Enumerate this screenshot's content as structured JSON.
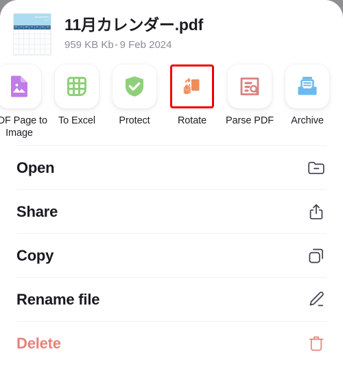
{
  "file": {
    "title": "11月カレンダー.pdf",
    "size": "959 KB Kb",
    "separator": "•",
    "date": "9 Feb 2024",
    "thumbnail": {
      "icon": "calendar-page-thumbnail",
      "month": "November",
      "year": "2024",
      "weekdays": [
        "Mo",
        "Tu",
        "We",
        "Th",
        "Fr",
        "Sa",
        "Su"
      ]
    }
  },
  "actions": [
    {
      "label": "PDF Page to Image",
      "icon": "pdf-page-to-image-icon",
      "color": "#c07ce8",
      "selected": false
    },
    {
      "label": "To Excel",
      "icon": "to-excel-grid-icon",
      "color": "#8ed07a",
      "selected": false
    },
    {
      "label": "Protect",
      "icon": "shield-check-icon",
      "color": "#8ed07a",
      "selected": false
    },
    {
      "label": "Rotate",
      "icon": "rotate-pages-icon",
      "color": "#ef8c57",
      "selected": true
    },
    {
      "label": "Parse PDF",
      "icon": "parse-pdf-search-icon",
      "color": "#d98080",
      "selected": false
    },
    {
      "label": "Archive",
      "icon": "archive-tray-icon",
      "color": "#6cb9ee",
      "selected": false
    }
  ],
  "menu": [
    {
      "label": "Open",
      "icon": "folder-minus-icon",
      "danger": false
    },
    {
      "label": "Share",
      "icon": "share-upload-icon",
      "danger": false
    },
    {
      "label": "Copy",
      "icon": "copy-squares-icon",
      "danger": false
    },
    {
      "label": "Rename file",
      "icon": "pencil-edit-icon",
      "danger": false
    },
    {
      "label": "Delete",
      "icon": "trash-icon",
      "danger": true
    }
  ],
  "colors": {
    "accent_selection": "#f10000",
    "danger": "#e8827c",
    "text_primary": "#191920",
    "text_secondary": "#8b8b96",
    "backdrop": "#8e8e93"
  }
}
